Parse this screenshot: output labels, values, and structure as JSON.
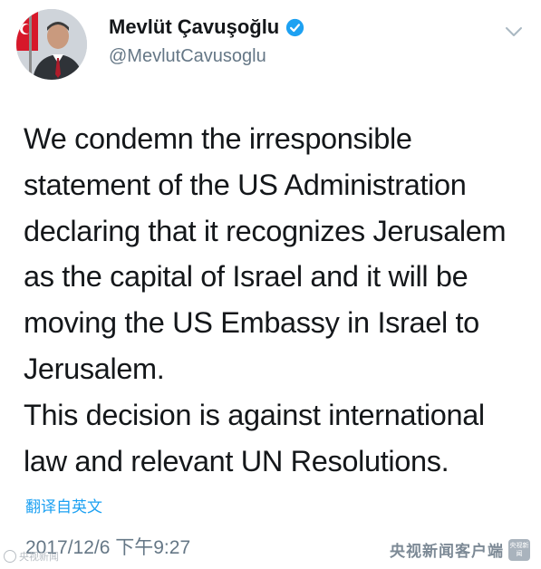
{
  "author": {
    "display_name": "Mevlüt Çavuşoğlu",
    "handle": "@MevlutCavusoglu",
    "verified": true
  },
  "tweet": {
    "lines": [
      "We condemn the irresponsible",
      "statement of the US Administration",
      "declaring that it recognizes Jerusalem",
      "as the capital of Israel and it will be",
      "moving the US Embassy in Israel to",
      "Jerusalem.",
      "This decision is against international",
      "law and relevant UN Resolutions."
    ],
    "translate_label": "翻译自英文",
    "timestamp": "2017/12/6 下午9:27"
  },
  "watermarks": {
    "left": "央视新闻",
    "right": "央视新闻客户端",
    "badge": "央视新闻"
  },
  "colors": {
    "text": "#14171a",
    "secondary": "#657786",
    "accent": "#1da1f2",
    "verified_badge": "#1da1f2"
  },
  "icons": {
    "verified": "verified-badge-icon",
    "menu": "chevron-down-icon"
  }
}
